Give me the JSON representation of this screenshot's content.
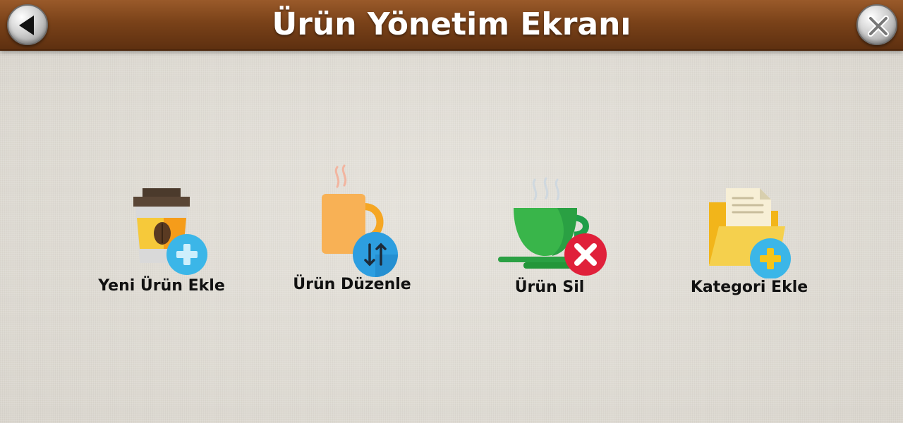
{
  "header": {
    "title": "Ürün Yönetim Ekranı",
    "back_icon": "back-arrow-icon",
    "close_icon": "close-icon"
  },
  "menu": {
    "items": [
      {
        "label": "Yeni Ürün Ekle",
        "icon": "coffee-cup-add-icon"
      },
      {
        "label": "Ürün Düzenle",
        "icon": "mug-edit-icon"
      },
      {
        "label": "Ürün Sil",
        "icon": "teacup-delete-icon"
      },
      {
        "label": "Kategori Ekle",
        "icon": "folder-add-icon"
      }
    ]
  },
  "colors": {
    "header_brown": "#7a4219",
    "badge_blue": "#3bb6e8",
    "badge_red": "#e0203a"
  }
}
